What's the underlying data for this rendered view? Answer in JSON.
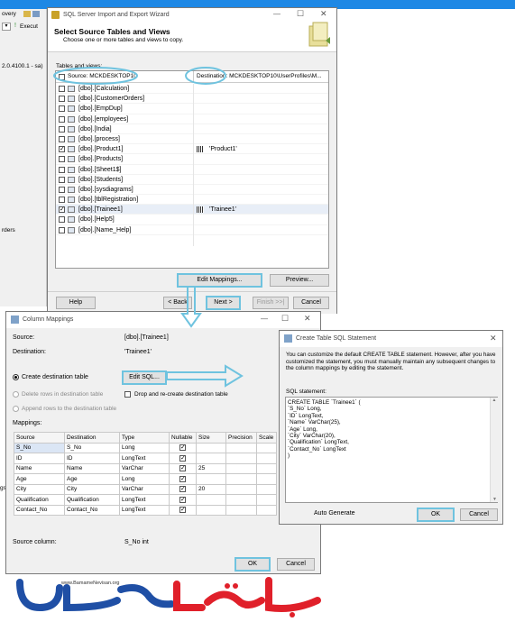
{
  "background_app": {
    "menu_fragment": "overy",
    "execute_label": "Execut",
    "server_fragment": "2.0.4100.1 - sa)",
    "orders_fragment": "rders",
    "gs_fragment": "gs"
  },
  "wizard": {
    "window_title": "SQL Server Import and Export Wizard",
    "header_title": "Select Source Tables and Views",
    "header_subtitle": "Choose one or more tables and views to copy.",
    "tables_label": "Tables and views:",
    "col_source": "Source: MCKDESKTOP10",
    "col_destination": "Destination: MCKDESKTOP10\\UserProfiles\\M...",
    "rows": [
      {
        "source": "[dbo].[Calculation]",
        "checked": false,
        "destination": ""
      },
      {
        "source": "[dbo].[CustomerOrders]",
        "checked": false,
        "destination": ""
      },
      {
        "source": "[dbo].[EmpDup]",
        "checked": false,
        "destination": ""
      },
      {
        "source": "[dbo].[employees]",
        "checked": false,
        "destination": ""
      },
      {
        "source": "[dbo].[India]",
        "checked": false,
        "destination": ""
      },
      {
        "source": "[dbo].[process]",
        "checked": false,
        "destination": ""
      },
      {
        "source": "[dbo].[Product1]",
        "checked": true,
        "destination": "'Product1'"
      },
      {
        "source": "[dbo].[Products]",
        "checked": false,
        "destination": ""
      },
      {
        "source": "[dbo].[Sheet1$]",
        "checked": false,
        "destination": ""
      },
      {
        "source": "[dbo].[Students]",
        "checked": false,
        "destination": ""
      },
      {
        "source": "[dbo].[sysdiagrams]",
        "checked": false,
        "destination": ""
      },
      {
        "source": "[dbo].[tblRegistration]",
        "checked": false,
        "destination": ""
      },
      {
        "source": "[dbo].[Trainee1]",
        "checked": true,
        "destination": "'Trainee1'"
      },
      {
        "source": "[dbo].[Help5]",
        "checked": false,
        "destination": ""
      },
      {
        "source": "[dbo].[Name_Help]",
        "checked": false,
        "destination": ""
      }
    ],
    "edit_mappings_label": "Edit Mappings...",
    "preview_label": "Preview...",
    "help_label": "Help",
    "back_label": "< Back",
    "next_label": "Next >",
    "finish_label": "Finish >>|",
    "cancel_label": "Cancel"
  },
  "column_mappings": {
    "window_title": "Column Mappings",
    "source_label": "Source:",
    "source_value": "[dbo].[Trainee1]",
    "destination_label": "Destination:",
    "destination_value": "'Trainee1'",
    "create_dest_label": "Create destination table",
    "edit_sql_label": "Edit SQL...",
    "delete_rows_label": "Delete rows in destination table",
    "drop_recreate_label": "Drop and re-create destination table",
    "append_rows_label": "Append rows to the destination table",
    "mappings_label": "Mappings:",
    "headers": [
      "Source",
      "Destination",
      "Type",
      "Nullable",
      "Size",
      "Precision",
      "Scale"
    ],
    "rows": [
      {
        "source": "S_No",
        "destination": "S_No",
        "type": "Long",
        "nullable": true,
        "size": "",
        "precision": "",
        "scale": ""
      },
      {
        "source": "ID",
        "destination": "ID",
        "type": "LongText",
        "nullable": true,
        "size": "",
        "precision": "",
        "scale": ""
      },
      {
        "source": "Name",
        "destination": "Name",
        "type": "VarChar",
        "nullable": true,
        "size": "25",
        "precision": "",
        "scale": ""
      },
      {
        "source": "Age",
        "destination": "Age",
        "type": "Long",
        "nullable": true,
        "size": "",
        "precision": "",
        "scale": ""
      },
      {
        "source": "City",
        "destination": "City",
        "type": "VarChar",
        "nullable": true,
        "size": "20",
        "precision": "",
        "scale": ""
      },
      {
        "source": "Qualification",
        "destination": "Qualification",
        "type": "LongText",
        "nullable": true,
        "size": "",
        "precision": "",
        "scale": ""
      },
      {
        "source": "Contact_No",
        "destination": "Contact_No",
        "type": "LongText",
        "nullable": true,
        "size": "",
        "precision": "",
        "scale": ""
      }
    ],
    "source_column_label": "Source column:",
    "source_column_value": "S_No int",
    "ok_label": "OK",
    "cancel_label": "Cancel"
  },
  "create_table": {
    "window_title": "Create Table SQL Statement",
    "description": "You can customize the default CREATE TABLE statement. However, after you have customized the statement, you must manually maintain any subsequent changes to the column mappings by editing the statement.",
    "sql_label": "SQL statement:",
    "sql_lines": [
      "CREATE TABLE `Trainee1` (",
      "`S_No` Long,",
      "`ID` LongText,",
      "`Name` VarChar(25),",
      "`Age` Long,",
      "`City` VarChar(20),",
      "`Qualification` LongText,",
      "`Contact_No` LongText",
      ")"
    ],
    "auto_generate_label": "Auto Generate",
    "ok_label": "OK",
    "cancel_label": "Cancel"
  },
  "watermark": {
    "url": "www.BamameNevisan.org",
    "logo_text": "برنامه نویسان"
  },
  "colors": {
    "highlight": "#6fc3df",
    "logo_blue": "#1f4fa5",
    "logo_red": "#e0202a"
  }
}
